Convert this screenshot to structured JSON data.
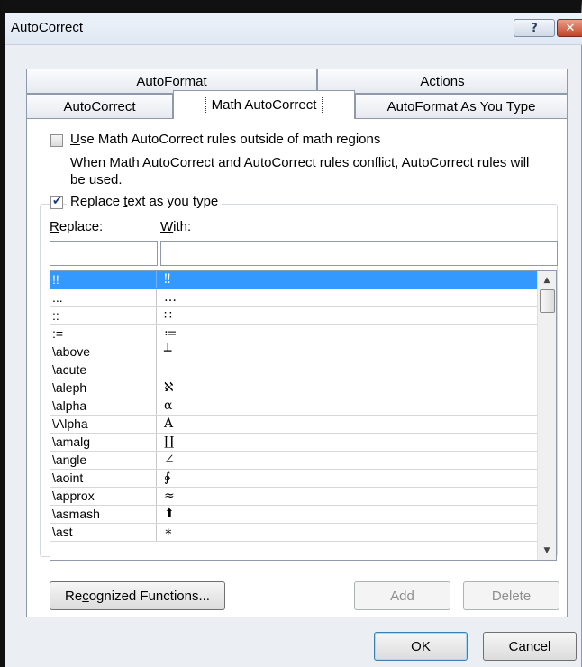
{
  "window": {
    "title": "AutoCorrect",
    "help_icon": "?",
    "close_icon": "✕"
  },
  "tabs": {
    "row1": [
      {
        "label": "AutoFormat"
      },
      {
        "label": "Actions"
      }
    ],
    "row2": [
      {
        "label": "AutoCorrect"
      },
      {
        "label": "Math AutoCorrect",
        "active": true
      },
      {
        "label": "AutoFormat As You Type"
      }
    ]
  },
  "options": {
    "use_outside": {
      "pre": "",
      "mnemonic": "U",
      "post": "se Math AutoCorrect rules outside of math regions",
      "checked": false
    },
    "conflict_note_line1": "When Math AutoCorrect and AutoCorrect rules conflict, AutoCorrect rules will",
    "conflict_note_line2": "be used.",
    "replace_as_type": {
      "pre": "Replace ",
      "mnemonic": "t",
      "post": "ext as you type",
      "checked": true
    }
  },
  "columns": {
    "replace": {
      "mnemonic": "R",
      "rest": "eplace:"
    },
    "with": {
      "mnemonic": "W",
      "rest": "ith:"
    }
  },
  "inputs": {
    "replace_value": "",
    "with_value": ""
  },
  "entries": [
    {
      "replace": "!!",
      "with": "‼",
      "selected": true
    },
    {
      "replace": "...",
      "with": "…"
    },
    {
      "replace": "::",
      "with": "∷"
    },
    {
      "replace": ":=",
      "with": "≔"
    },
    {
      "replace": "\\above",
      "with": "┴"
    },
    {
      "replace": "\\acute",
      "with": ""
    },
    {
      "replace": "\\aleph",
      "with": "ℵ"
    },
    {
      "replace": "\\alpha",
      "with": "α"
    },
    {
      "replace": "\\Alpha",
      "with": "Α"
    },
    {
      "replace": "\\amalg",
      "with": "∐"
    },
    {
      "replace": "\\angle",
      "with": "∠"
    },
    {
      "replace": "\\aoint",
      "with": "∳"
    },
    {
      "replace": "\\approx",
      "with": "≈"
    },
    {
      "replace": "\\asmash",
      "with": "⬆"
    },
    {
      "replace": "\\ast",
      "with": "∗"
    }
  ],
  "buttons": {
    "recognized": {
      "pre": "Re",
      "mnemonic": "c",
      "post": "ognized Functions..."
    },
    "add": "Add",
    "delete": "Delete",
    "ok": "OK",
    "cancel": "Cancel"
  },
  "colors": {
    "selection": "#3399ff",
    "dialog_bg": "#ebeef2"
  }
}
